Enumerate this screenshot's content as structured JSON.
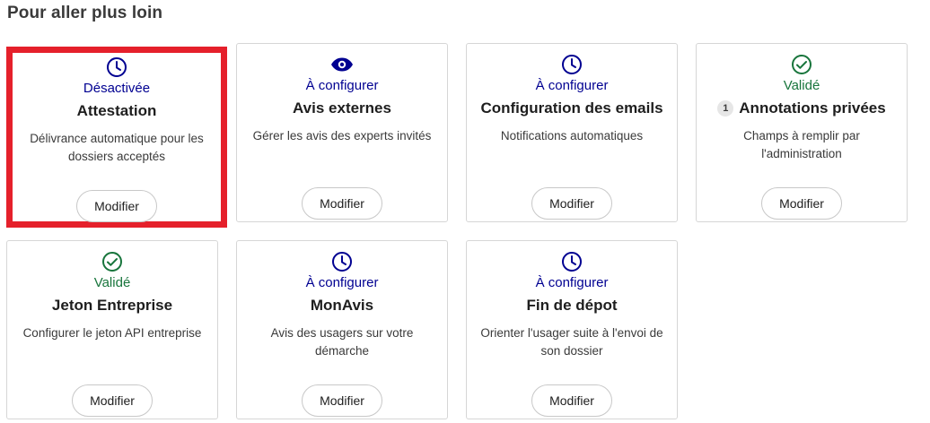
{
  "section": {
    "title": "Pour aller plus loin"
  },
  "colors": {
    "todo": "#000091",
    "ok": "#18753c",
    "highlight": "#e5202b"
  },
  "cards": [
    {
      "icon": "clock-icon",
      "status": "Désactivée",
      "title": "Attestation",
      "description": "Délivrance automatique pour les dossiers acceptés",
      "button": "Modifier"
    },
    {
      "icon": "eye-icon",
      "status": "À configurer",
      "title": "Avis externes",
      "description": "Gérer les avis des experts invités",
      "button": "Modifier"
    },
    {
      "icon": "clock-icon",
      "status": "À configurer",
      "title": "Configuration des emails",
      "description": "Notifications automatiques",
      "button": "Modifier"
    },
    {
      "icon": "check-circle-icon",
      "status": "Validé",
      "badge": "1",
      "title": "Annotations privées",
      "description": "Champs à remplir par l'administration",
      "button": "Modifier"
    },
    {
      "icon": "check-circle-icon",
      "status": "Validé",
      "title": "Jeton Entreprise",
      "description": "Configurer le jeton API entreprise",
      "button": "Modifier"
    },
    {
      "icon": "clock-icon",
      "status": "À configurer",
      "title": "MonAvis",
      "description": "Avis des usagers sur votre démarche",
      "button": "Modifier"
    },
    {
      "icon": "clock-icon",
      "status": "À configurer",
      "title": "Fin de dépot",
      "description": "Orienter l'usager suite à l'envoi de son dossier",
      "button": "Modifier"
    }
  ]
}
